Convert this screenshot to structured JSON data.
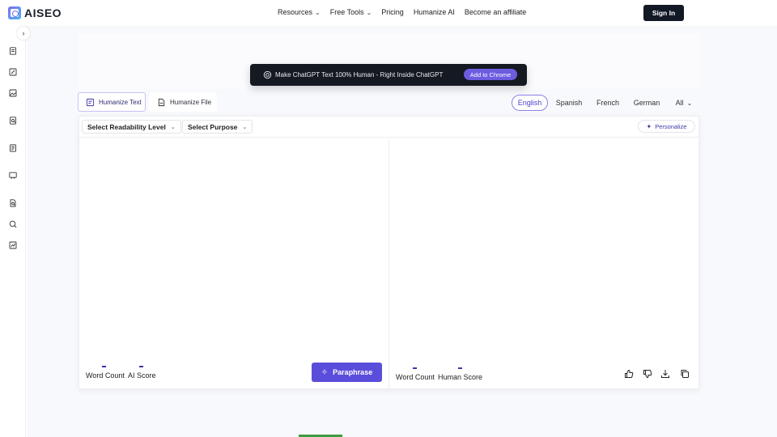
{
  "brand": {
    "name": "AISEO"
  },
  "nav": {
    "items": [
      {
        "label": "Resources",
        "has_dropdown": true
      },
      {
        "label": "Free Tools",
        "has_dropdown": true
      },
      {
        "label": "Pricing",
        "has_dropdown": false
      },
      {
        "label": "Humanize AI",
        "has_dropdown": false
      },
      {
        "label": "Become an affiliate",
        "has_dropdown": false
      }
    ],
    "signin_label": "Sign In"
  },
  "sidebar": {
    "icons": [
      "document-icon",
      "edit-document-icon",
      "image-edit-icon",
      "search-document-icon",
      "text-document-icon",
      "slideshow-icon",
      "file-search-icon",
      "magnify-icon",
      "analytics-icon"
    ]
  },
  "banner": {
    "text": "Make ChatGPT Text 100% Human - Right Inside ChatGPT",
    "button_label": "Add to Chrome"
  },
  "modes": {
    "humanize_text": "Humanize Text",
    "humanize_file": "Humanize File",
    "active": "humanize_text"
  },
  "languages": {
    "items": [
      "English",
      "Spanish",
      "French",
      "German"
    ],
    "all_label": "All",
    "active": "English"
  },
  "toolbar": {
    "readability_label": "Select Readability Level",
    "purpose_label": "Select Purpose",
    "personalize_label": "Personalize"
  },
  "input_panel": {
    "word_count_label": "Word Count",
    "ai_score_label": "AI Score",
    "paraphrase_label": "Paraphrase"
  },
  "output_panel": {
    "word_count_label": "Word Count",
    "human_score_label": "Human Score"
  },
  "colors": {
    "accent": "#5b4ddb",
    "dark": "#121826",
    "background": "#f8f9fc"
  }
}
